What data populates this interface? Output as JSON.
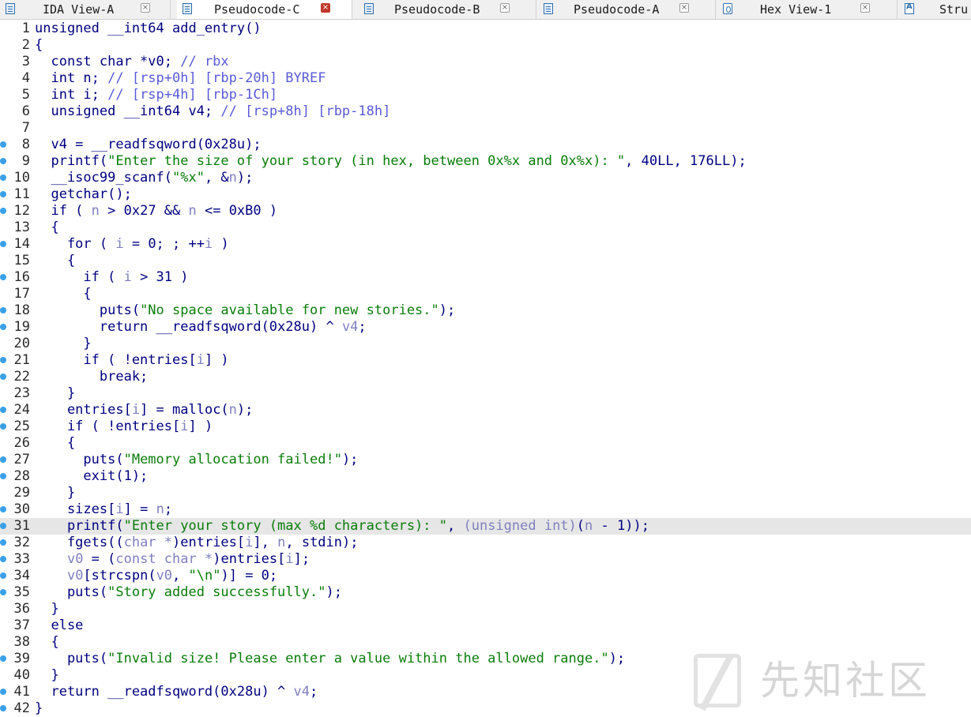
{
  "tabs": [
    {
      "label": "IDA View-A",
      "icon": "ida-view-icon",
      "active": false
    },
    {
      "label": "Pseudocode-C",
      "icon": "pseudocode-icon",
      "active": true
    },
    {
      "label": "Pseudocode-B",
      "icon": "pseudocode-icon",
      "active": false
    },
    {
      "label": "Pseudocode-A",
      "icon": "pseudocode-icon",
      "active": false
    },
    {
      "label": "Hex View-1",
      "icon": "hex-view-icon",
      "active": false
    },
    {
      "label": "Stru",
      "icon": "structures-icon",
      "active": false
    }
  ],
  "close_glyph": "×",
  "colors": {
    "code": "#000080",
    "comment": "#5a5ad8",
    "string": "#0a7d0a",
    "variable": "#8080c0",
    "breakpoint": "#3aa0e8",
    "highlight": "#e6e6e6"
  },
  "highlighted_line": 31,
  "watermark": "先知社区",
  "lines": [
    {
      "n": 1,
      "bp": false,
      "segs": [
        {
          "c": "",
          "t": "unsigned __int64 add_entry()"
        }
      ]
    },
    {
      "n": 2,
      "bp": false,
      "segs": [
        {
          "c": "",
          "t": "{"
        }
      ]
    },
    {
      "n": 3,
      "bp": false,
      "segs": [
        {
          "c": "",
          "t": "  const char *v0; "
        },
        {
          "c": "c",
          "t": "// rbx"
        }
      ]
    },
    {
      "n": 4,
      "bp": false,
      "segs": [
        {
          "c": "",
          "t": "  int n; "
        },
        {
          "c": "c",
          "t": "// [rsp+0h] [rbp-20h] BYREF"
        }
      ]
    },
    {
      "n": 5,
      "bp": false,
      "segs": [
        {
          "c": "",
          "t": "  int i; "
        },
        {
          "c": "c",
          "t": "// [rsp+4h] [rbp-1Ch]"
        }
      ]
    },
    {
      "n": 6,
      "bp": false,
      "segs": [
        {
          "c": "",
          "t": "  unsigned __int64 v4; "
        },
        {
          "c": "c",
          "t": "// [rsp+8h] [rbp-18h]"
        }
      ]
    },
    {
      "n": 7,
      "bp": false,
      "segs": [
        {
          "c": "",
          "t": ""
        }
      ]
    },
    {
      "n": 8,
      "bp": true,
      "segs": [
        {
          "c": "",
          "t": "  v4 = __readfsqword(0x28u);"
        }
      ]
    },
    {
      "n": 9,
      "bp": true,
      "segs": [
        {
          "c": "",
          "t": "  printf("
        },
        {
          "c": "s",
          "t": "\"Enter the size of your story (in hex, between 0x%x and 0x%x): \""
        },
        {
          "c": "",
          "t": ", 40LL, 176LL);"
        }
      ]
    },
    {
      "n": 10,
      "bp": true,
      "segs": [
        {
          "c": "",
          "t": "  __isoc99_scanf("
        },
        {
          "c": "s",
          "t": "\"%x\""
        },
        {
          "c": "",
          "t": ", &"
        },
        {
          "c": "v",
          "t": "n"
        },
        {
          "c": "",
          "t": ");"
        }
      ]
    },
    {
      "n": 11,
      "bp": true,
      "segs": [
        {
          "c": "",
          "t": "  getchar();"
        }
      ]
    },
    {
      "n": 12,
      "bp": true,
      "segs": [
        {
          "c": "",
          "t": "  if ( "
        },
        {
          "c": "v",
          "t": "n"
        },
        {
          "c": "",
          "t": " > 0x27 && "
        },
        {
          "c": "v",
          "t": "n"
        },
        {
          "c": "",
          "t": " <= 0xB0 )"
        }
      ]
    },
    {
      "n": 13,
      "bp": false,
      "segs": [
        {
          "c": "",
          "t": "  {"
        }
      ]
    },
    {
      "n": 14,
      "bp": true,
      "segs": [
        {
          "c": "",
          "t": "    for ( "
        },
        {
          "c": "v",
          "t": "i"
        },
        {
          "c": "",
          "t": " = 0; ; ++"
        },
        {
          "c": "v",
          "t": "i"
        },
        {
          "c": "",
          "t": " )"
        }
      ]
    },
    {
      "n": 15,
      "bp": false,
      "segs": [
        {
          "c": "",
          "t": "    {"
        }
      ]
    },
    {
      "n": 16,
      "bp": true,
      "segs": [
        {
          "c": "",
          "t": "      if ( "
        },
        {
          "c": "v",
          "t": "i"
        },
        {
          "c": "",
          "t": " > 31 )"
        }
      ]
    },
    {
      "n": 17,
      "bp": false,
      "segs": [
        {
          "c": "",
          "t": "      {"
        }
      ]
    },
    {
      "n": 18,
      "bp": true,
      "segs": [
        {
          "c": "",
          "t": "        puts("
        },
        {
          "c": "s",
          "t": "\"No space available for new stories.\""
        },
        {
          "c": "",
          "t": ");"
        }
      ]
    },
    {
      "n": 19,
      "bp": true,
      "segs": [
        {
          "c": "",
          "t": "        return __readfsqword(0x28u) ^ "
        },
        {
          "c": "v",
          "t": "v4"
        },
        {
          "c": "",
          "t": ";"
        }
      ]
    },
    {
      "n": 20,
      "bp": false,
      "segs": [
        {
          "c": "",
          "t": "      }"
        }
      ]
    },
    {
      "n": 21,
      "bp": true,
      "segs": [
        {
          "c": "",
          "t": "      if ( !entries["
        },
        {
          "c": "v",
          "t": "i"
        },
        {
          "c": "",
          "t": "] )"
        }
      ]
    },
    {
      "n": 22,
      "bp": true,
      "segs": [
        {
          "c": "",
          "t": "        break;"
        }
      ]
    },
    {
      "n": 23,
      "bp": false,
      "segs": [
        {
          "c": "",
          "t": "    }"
        }
      ]
    },
    {
      "n": 24,
      "bp": true,
      "segs": [
        {
          "c": "",
          "t": "    entries["
        },
        {
          "c": "v",
          "t": "i"
        },
        {
          "c": "",
          "t": "] = malloc("
        },
        {
          "c": "v",
          "t": "n"
        },
        {
          "c": "",
          "t": ");"
        }
      ]
    },
    {
      "n": 25,
      "bp": true,
      "segs": [
        {
          "c": "",
          "t": "    if ( !entries["
        },
        {
          "c": "v",
          "t": "i"
        },
        {
          "c": "",
          "t": "] )"
        }
      ]
    },
    {
      "n": 26,
      "bp": false,
      "segs": [
        {
          "c": "",
          "t": "    {"
        }
      ]
    },
    {
      "n": 27,
      "bp": true,
      "segs": [
        {
          "c": "",
          "t": "      puts("
        },
        {
          "c": "s",
          "t": "\"Memory allocation failed!\""
        },
        {
          "c": "",
          "t": ");"
        }
      ]
    },
    {
      "n": 28,
      "bp": true,
      "segs": [
        {
          "c": "",
          "t": "      exit(1);"
        }
      ]
    },
    {
      "n": 29,
      "bp": false,
      "segs": [
        {
          "c": "",
          "t": "    }"
        }
      ]
    },
    {
      "n": 30,
      "bp": true,
      "segs": [
        {
          "c": "",
          "t": "    sizes["
        },
        {
          "c": "v",
          "t": "i"
        },
        {
          "c": "",
          "t": "] = "
        },
        {
          "c": "v",
          "t": "n"
        },
        {
          "c": "",
          "t": ";"
        }
      ]
    },
    {
      "n": 31,
      "bp": true,
      "segs": [
        {
          "c": "",
          "t": "    printf("
        },
        {
          "c": "s",
          "t": "\"Enter your story (max %d characters): \""
        },
        {
          "c": "",
          "t": ", "
        },
        {
          "c": "v",
          "t": "(unsigned int)"
        },
        {
          "c": "",
          "t": "("
        },
        {
          "c": "v",
          "t": "n"
        },
        {
          "c": "",
          "t": " - 1));"
        }
      ]
    },
    {
      "n": 32,
      "bp": true,
      "segs": [
        {
          "c": "",
          "t": "    fgets(("
        },
        {
          "c": "v",
          "t": "char *"
        },
        {
          "c": "",
          "t": ")entries["
        },
        {
          "c": "v",
          "t": "i"
        },
        {
          "c": "",
          "t": "], "
        },
        {
          "c": "v",
          "t": "n"
        },
        {
          "c": "",
          "t": ", stdin);"
        }
      ]
    },
    {
      "n": 33,
      "bp": true,
      "segs": [
        {
          "c": "",
          "t": "    "
        },
        {
          "c": "v",
          "t": "v0"
        },
        {
          "c": "",
          "t": " = ("
        },
        {
          "c": "v",
          "t": "const char *"
        },
        {
          "c": "",
          "t": ")entries["
        },
        {
          "c": "v",
          "t": "i"
        },
        {
          "c": "",
          "t": "];"
        }
      ]
    },
    {
      "n": 34,
      "bp": true,
      "segs": [
        {
          "c": "",
          "t": "    "
        },
        {
          "c": "v",
          "t": "v0"
        },
        {
          "c": "",
          "t": "[strcspn("
        },
        {
          "c": "v",
          "t": "v0"
        },
        {
          "c": "",
          "t": ", "
        },
        {
          "c": "s",
          "t": "\"\\n\""
        },
        {
          "c": "",
          "t": ")] = 0;"
        }
      ]
    },
    {
      "n": 35,
      "bp": true,
      "segs": [
        {
          "c": "",
          "t": "    puts("
        },
        {
          "c": "s",
          "t": "\"Story added successfully.\""
        },
        {
          "c": "",
          "t": ");"
        }
      ]
    },
    {
      "n": 36,
      "bp": false,
      "segs": [
        {
          "c": "",
          "t": "  }"
        }
      ]
    },
    {
      "n": 37,
      "bp": false,
      "segs": [
        {
          "c": "",
          "t": "  else"
        }
      ]
    },
    {
      "n": 38,
      "bp": false,
      "segs": [
        {
          "c": "",
          "t": "  {"
        }
      ]
    },
    {
      "n": 39,
      "bp": true,
      "segs": [
        {
          "c": "",
          "t": "    puts("
        },
        {
          "c": "s",
          "t": "\"Invalid size! Please enter a value within the allowed range.\""
        },
        {
          "c": "",
          "t": ");"
        }
      ]
    },
    {
      "n": 40,
      "bp": false,
      "segs": [
        {
          "c": "",
          "t": "  }"
        }
      ]
    },
    {
      "n": 41,
      "bp": true,
      "segs": [
        {
          "c": "",
          "t": "  return __readfsqword(0x28u) ^ "
        },
        {
          "c": "v",
          "t": "v4"
        },
        {
          "c": "",
          "t": ";"
        }
      ]
    },
    {
      "n": 42,
      "bp": true,
      "segs": [
        {
          "c": "",
          "t": "}"
        }
      ]
    }
  ]
}
